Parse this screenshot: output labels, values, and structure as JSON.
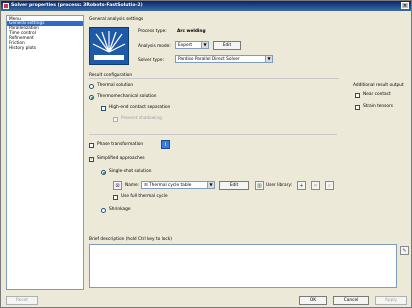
{
  "window": {
    "title": "Solver properties (process: 3Robots-FastSolutio-2)",
    "close_glyph": "×"
  },
  "nav": {
    "title": "Menu",
    "items": [
      {
        "label": "General settings",
        "selected": true
      },
      {
        "label": "Parallelization",
        "selected": false
      },
      {
        "label": "Time control",
        "selected": false
      },
      {
        "label": "Refinement",
        "selected": false
      },
      {
        "label": "Friction",
        "selected": false
      },
      {
        "label": "History plots",
        "selected": false
      }
    ]
  },
  "general": {
    "section_label": "General analysis settings",
    "process_type_label": "Process type:",
    "process_type_value": "Arc welding",
    "analysis_mode_label": "Analysis mode:",
    "analysis_mode_value": "Expert",
    "edit_label": "Edit",
    "solver_type_label": "Solver type:",
    "solver_type_value": "Pardiso Parallel Direct Solver"
  },
  "result": {
    "section_label": "Result configuration",
    "thermal_solution": "Thermal solution",
    "thermomech_solution": "Thermomechanical solution",
    "high_end_contact": "High-end contact separation",
    "prevent_shadowing": "Prevent shadowing",
    "additional_output_label": "Additional result output",
    "near_contact": "Near contact",
    "strain_tensors": "Strain tensors"
  },
  "phase": {
    "label": "Phase transformation"
  },
  "simplified": {
    "label": "Simplified approaches",
    "single_shot": "Single-shot solution",
    "name_label": "Name:",
    "name_value": "Thermal cycle table",
    "edit_label": "Edit",
    "user_library_label": "User library:",
    "use_full_cycle": "Use full thermal cycle",
    "shrinkage": "Shrinkage"
  },
  "brief": {
    "label": "Brief description (hold Ctrl key to lock)"
  },
  "footer": {
    "reset": "Reset",
    "ok": "OK",
    "cancel": "Cancel",
    "apply": "Apply"
  },
  "icons": {
    "dropdown": "dropdown-arrow-icon",
    "add": "add-icon",
    "delete": "delete-icon",
    "search": "search-icon"
  }
}
